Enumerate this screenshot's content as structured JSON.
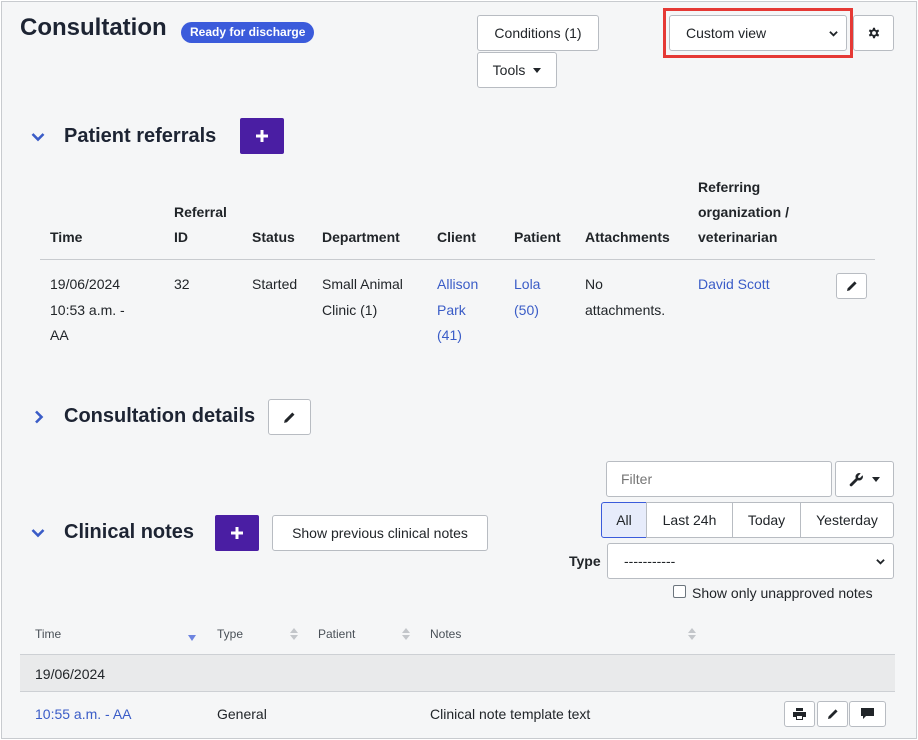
{
  "header": {
    "title": "Consultation",
    "status_badge": "Ready for discharge",
    "conditions_label": "Conditions (1)",
    "tools_label": "Tools",
    "view_select": "Custom view",
    "settings_icon": "gear-icon"
  },
  "referrals": {
    "title": "Patient referrals",
    "columns": {
      "time": "Time",
      "referral_id_line1": "Referral",
      "referral_id_line2": "ID",
      "status": "Status",
      "department": "Department",
      "client": "Client",
      "patient": "Patient",
      "attachments": "Attachments",
      "org_line1": "Referring",
      "org_line2": "organization /",
      "org_line3": "veterinarian"
    },
    "row": {
      "time_line1": "19/06/2024",
      "time_line2": "10:53 a.m. -",
      "time_line3": "AA",
      "referral_id": "32",
      "status": "Started",
      "department_line1": "Small Animal",
      "department_line2": "Clinic (1)",
      "client_line1": "Allison",
      "client_line2": "Park",
      "client_line3": "(41)",
      "patient_line1": "Lola",
      "patient_line2": "(50)",
      "attachments_line1": "No",
      "attachments_line2": "attachments.",
      "organization": "David Scott"
    }
  },
  "details": {
    "title": "Consultation details"
  },
  "clinical_notes": {
    "title": "Clinical notes",
    "show_previous_label": "Show previous clinical notes",
    "filter_placeholder": "Filter",
    "periods": [
      "All",
      "Last 24h",
      "Today",
      "Yesterday"
    ],
    "active_period": "All",
    "type_label": "Type",
    "type_value": "-----------",
    "unapproved_label": "Show only unapproved notes",
    "columns": {
      "time": "Time",
      "type": "Type",
      "patient": "Patient",
      "notes": "Notes"
    },
    "date_group": "19/06/2024",
    "rows": [
      {
        "time": "10:55 a.m. - AA",
        "type": "General",
        "patient": "",
        "notes": "Clinical note template text"
      }
    ]
  },
  "colors": {
    "accent": "#4a1ea3",
    "badge": "#3b5bdb",
    "link": "#3a5cc7",
    "highlight": "#e53935"
  }
}
